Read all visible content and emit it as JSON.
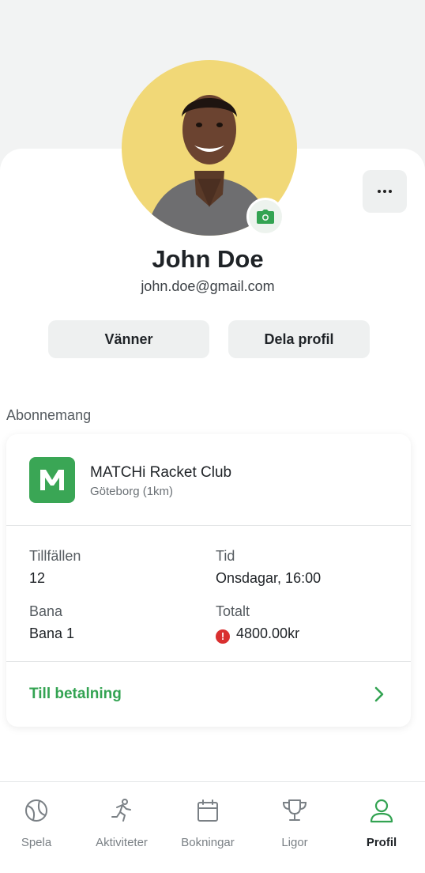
{
  "profile": {
    "name": "John Doe",
    "email": "john.doe@gmail.com"
  },
  "actions": {
    "friends_label": "Vänner",
    "share_label": "Dela profil"
  },
  "subscription": {
    "section_label": "Abonnemang",
    "club_name": "MATCHi Racket Club",
    "club_location": "Göteborg (1km)",
    "club_logo_letter": "M",
    "occasions_label": "Tillfällen",
    "occasions_value": "12",
    "time_label": "Tid",
    "time_value": "Onsdagar, 16:00",
    "court_label": "Bana",
    "court_value": "Bana 1",
    "total_label": "Totalt",
    "total_value": "4800.00kr",
    "pay_label": "Till betalning"
  },
  "tabs": [
    {
      "label": "Spela",
      "icon": "tennis-ball-icon"
    },
    {
      "label": "Aktiviteter",
      "icon": "runner-icon"
    },
    {
      "label": "Bokningar",
      "icon": "calendar-icon"
    },
    {
      "label": "Ligor",
      "icon": "trophy-icon"
    },
    {
      "label": "Profil",
      "icon": "user-icon",
      "active": true
    }
  ],
  "colors": {
    "accent": "#33a352",
    "avatar_bg": "#f1d877",
    "warning": "#d92f2f"
  }
}
